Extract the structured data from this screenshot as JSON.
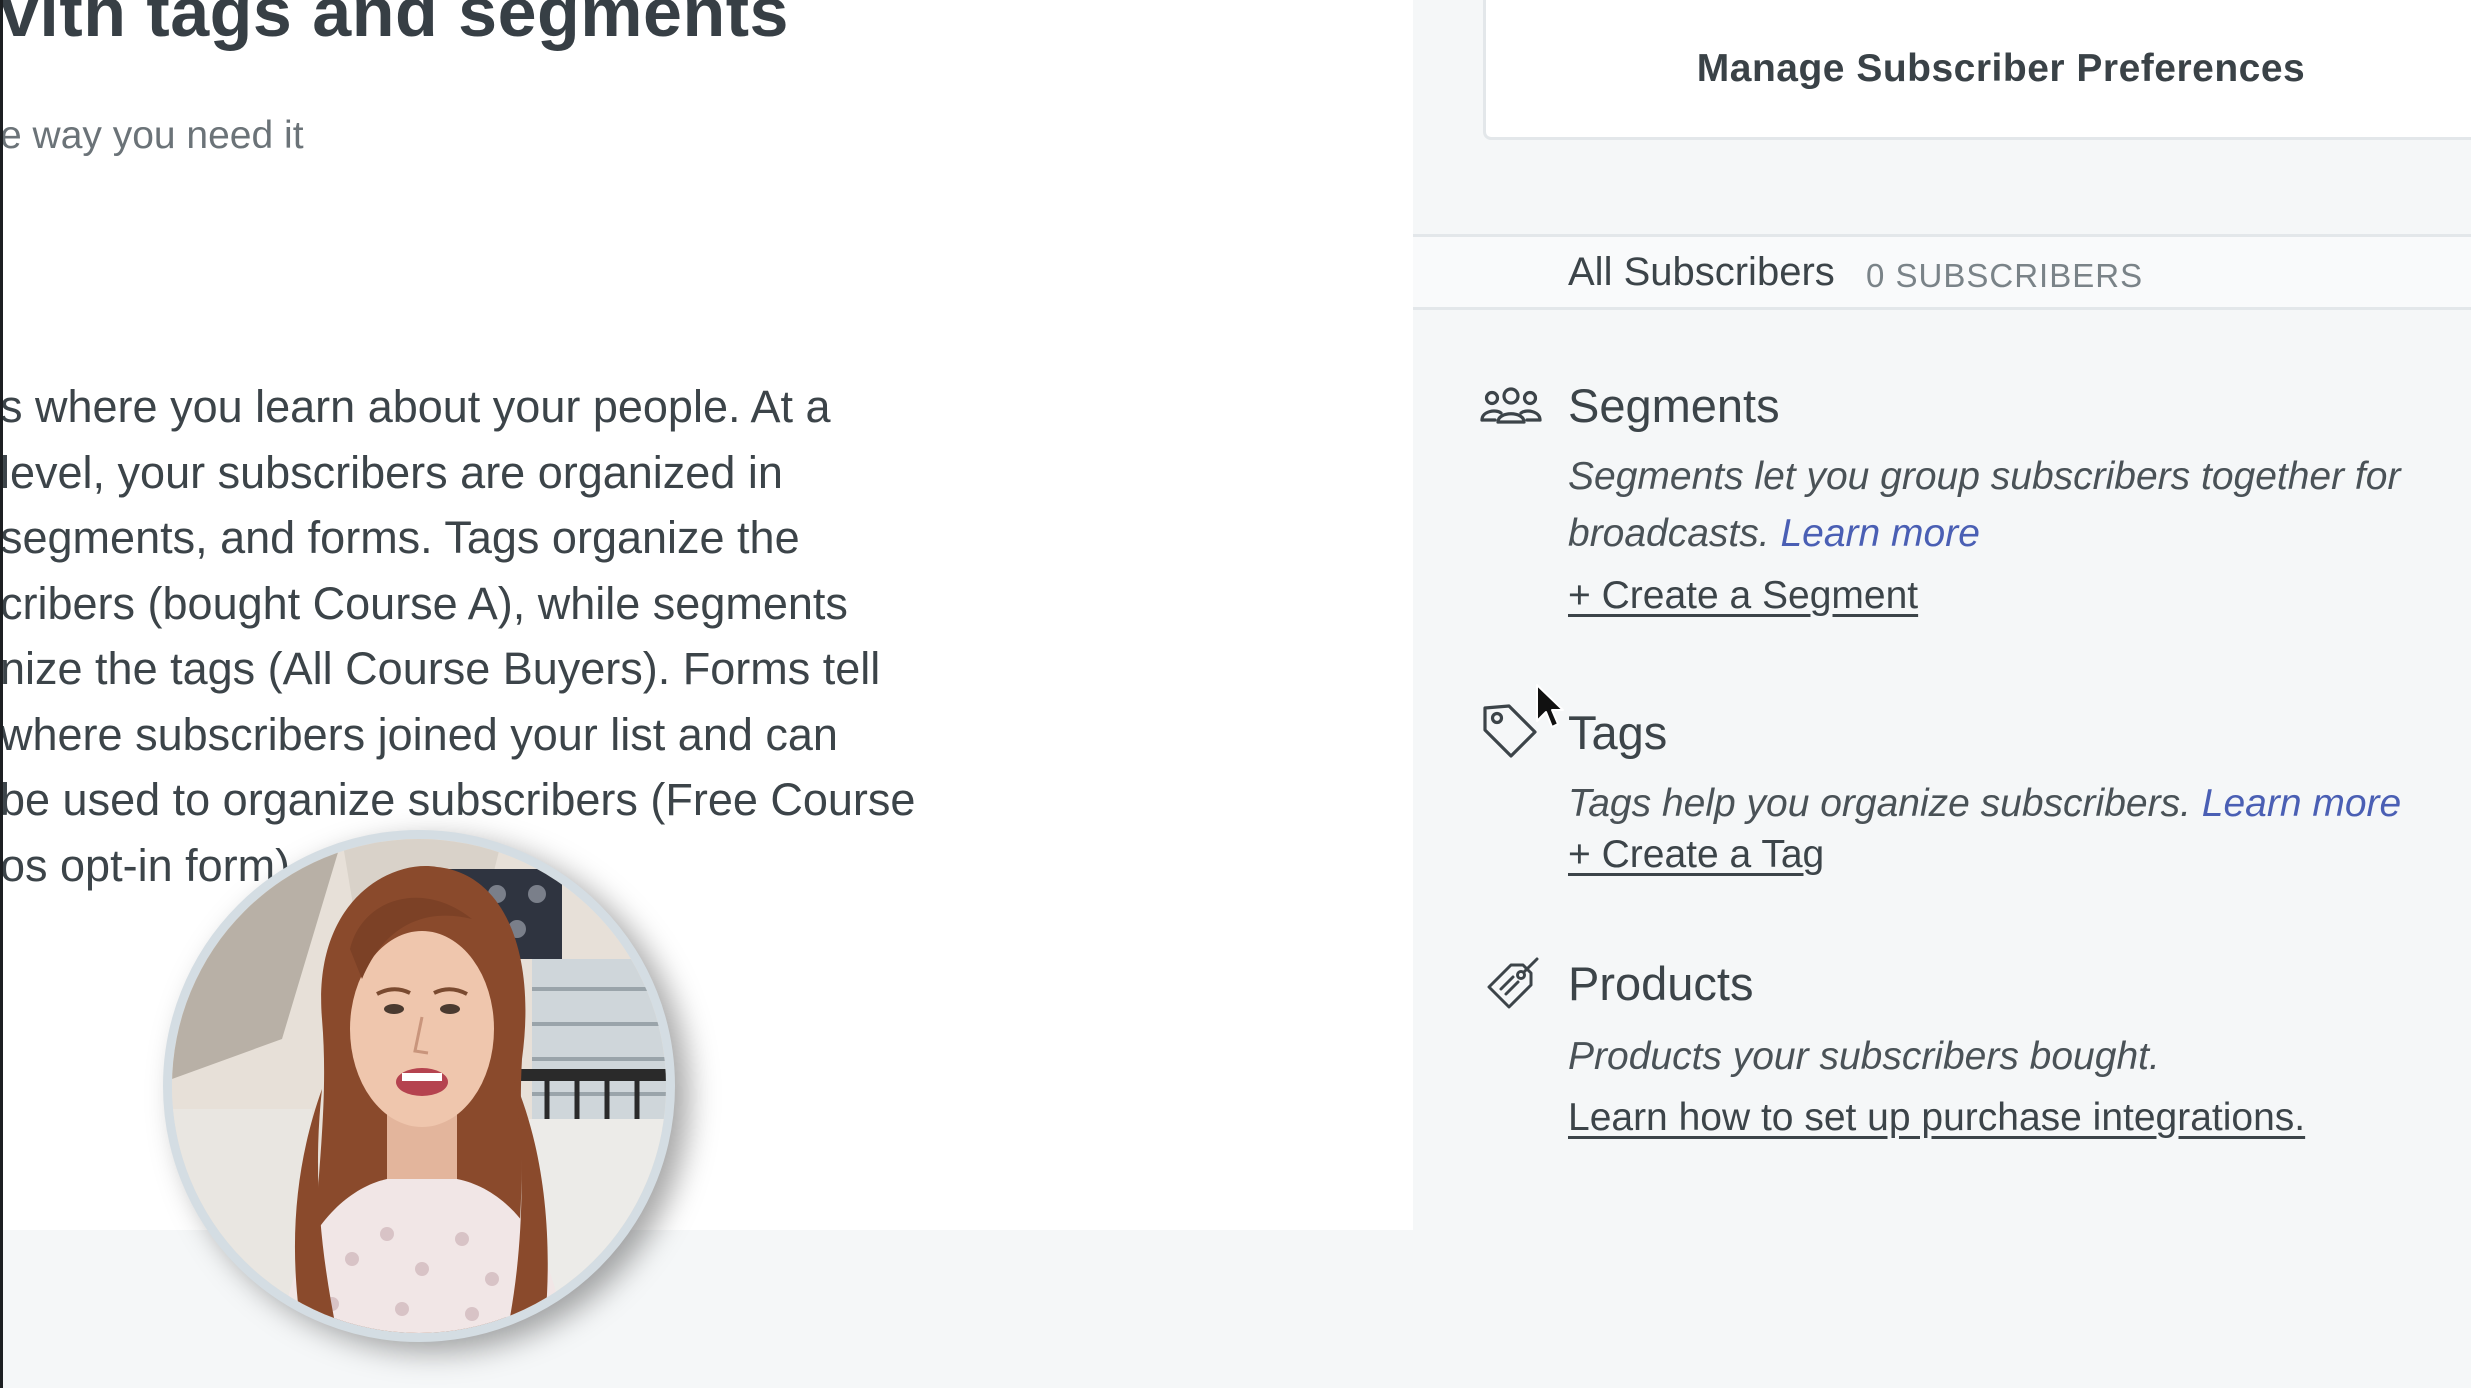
{
  "main": {
    "title": "vith tags and segments",
    "subtitle": "e way you need it",
    "intro_lines": [
      "s where you learn about your people. At a",
      " level, your subscribers are organized in",
      " segments, and forms. Tags organize the",
      "cribers (bought Course A), while segments",
      "nize the tags (All Course Buyers). Forms tell",
      "where subscribers joined your list and can",
      "be used to organize subscribers (Free Course",
      "os opt-in form)"
    ]
  },
  "sidebar": {
    "manage_button_label": "Manage Subscriber Preferences",
    "all_subscribers": {
      "label": "All Subscribers",
      "count": "0 SUBSCRIBERS"
    },
    "segments": {
      "title": "Segments",
      "description": "Segments let you group subscribers together for broadcasts.",
      "learn_more": "Learn more",
      "action": "+ Create a Segment",
      "icon": "people-group-icon"
    },
    "tags": {
      "title": "Tags",
      "description": "Tags help you organize subscribers.",
      "learn_more": "Learn more",
      "action": "+ Create a Tag",
      "icon": "tag-icon"
    },
    "products": {
      "title": "Products",
      "description": "Products your subscribers bought.",
      "action": "Learn how to set up purchase integrations.",
      "icon": "price-tag-icon"
    }
  },
  "colors": {
    "text_primary": "#373f45",
    "link_blue": "#4a5fb4",
    "sidebar_bg": "#f5f7f8",
    "border": "#e3e7ea"
  }
}
